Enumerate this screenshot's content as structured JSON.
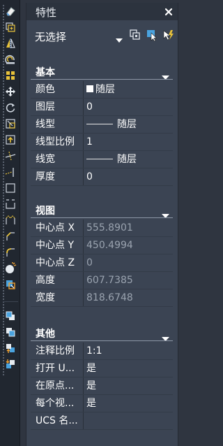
{
  "panel": {
    "title": "特性",
    "selector": {
      "value": "无选择"
    }
  },
  "sections": {
    "basic": {
      "header": "基本",
      "rows": [
        {
          "label": "颜色",
          "value": "随层"
        },
        {
          "label": "图层",
          "value": "0"
        },
        {
          "label": "线型",
          "value": "随层"
        },
        {
          "label": "线型比例",
          "value": "1"
        },
        {
          "label": "线宽",
          "value": "随层"
        },
        {
          "label": "厚度",
          "value": "0"
        }
      ]
    },
    "view": {
      "header": "视图",
      "rows": [
        {
          "label": "中心点 X",
          "value": "555.8901"
        },
        {
          "label": "中心点 Y",
          "value": "450.4994"
        },
        {
          "label": "中心点 Z",
          "value": "0"
        },
        {
          "label": "高度",
          "value": "607.7385"
        },
        {
          "label": "宽度",
          "value": "818.6748"
        }
      ]
    },
    "other": {
      "header": "其他",
      "rows": [
        {
          "label": "注释比例",
          "value": "1:1"
        },
        {
          "label": "打开 U...",
          "value": "是"
        },
        {
          "label": "在原点...",
          "value": "是"
        },
        {
          "label": "每个视...",
          "value": "是"
        },
        {
          "label": "UCS 名...",
          "value": ""
        }
      ]
    }
  },
  "icons": {
    "close": "close-icon",
    "selector_dropdown": "chevron-down-icon",
    "quick_select": "quick-select-icon",
    "select_objects": "select-objects-icon",
    "toggle_pickadd": "pickadd-toggle-icon",
    "toolbar": [
      "erase-icon",
      "copy-icon",
      "mirror-icon",
      "offset-icon",
      "array-icon",
      "move-icon",
      "rotate-icon",
      "scale-icon",
      "stretch-icon",
      "trim-icon",
      "extend-icon",
      "break-at-point-icon",
      "break-icon",
      "join-icon",
      "chamfer-icon",
      "fillet-icon",
      "blend-icon",
      "explode-icon",
      "draw-order-front-icon",
      "draw-order-back-icon",
      "draw-order-above-icon",
      "draw-order-below-icon"
    ]
  },
  "colors": {
    "panel_bg": "#3b4453",
    "title_bg": "#2c333e",
    "toolbar_bg": "#212730",
    "dim_text": "#9aa3af",
    "accent_blue": "#4aa3df",
    "accent_orange": "#f0a030",
    "accent_yellow": "#e8c23a"
  }
}
